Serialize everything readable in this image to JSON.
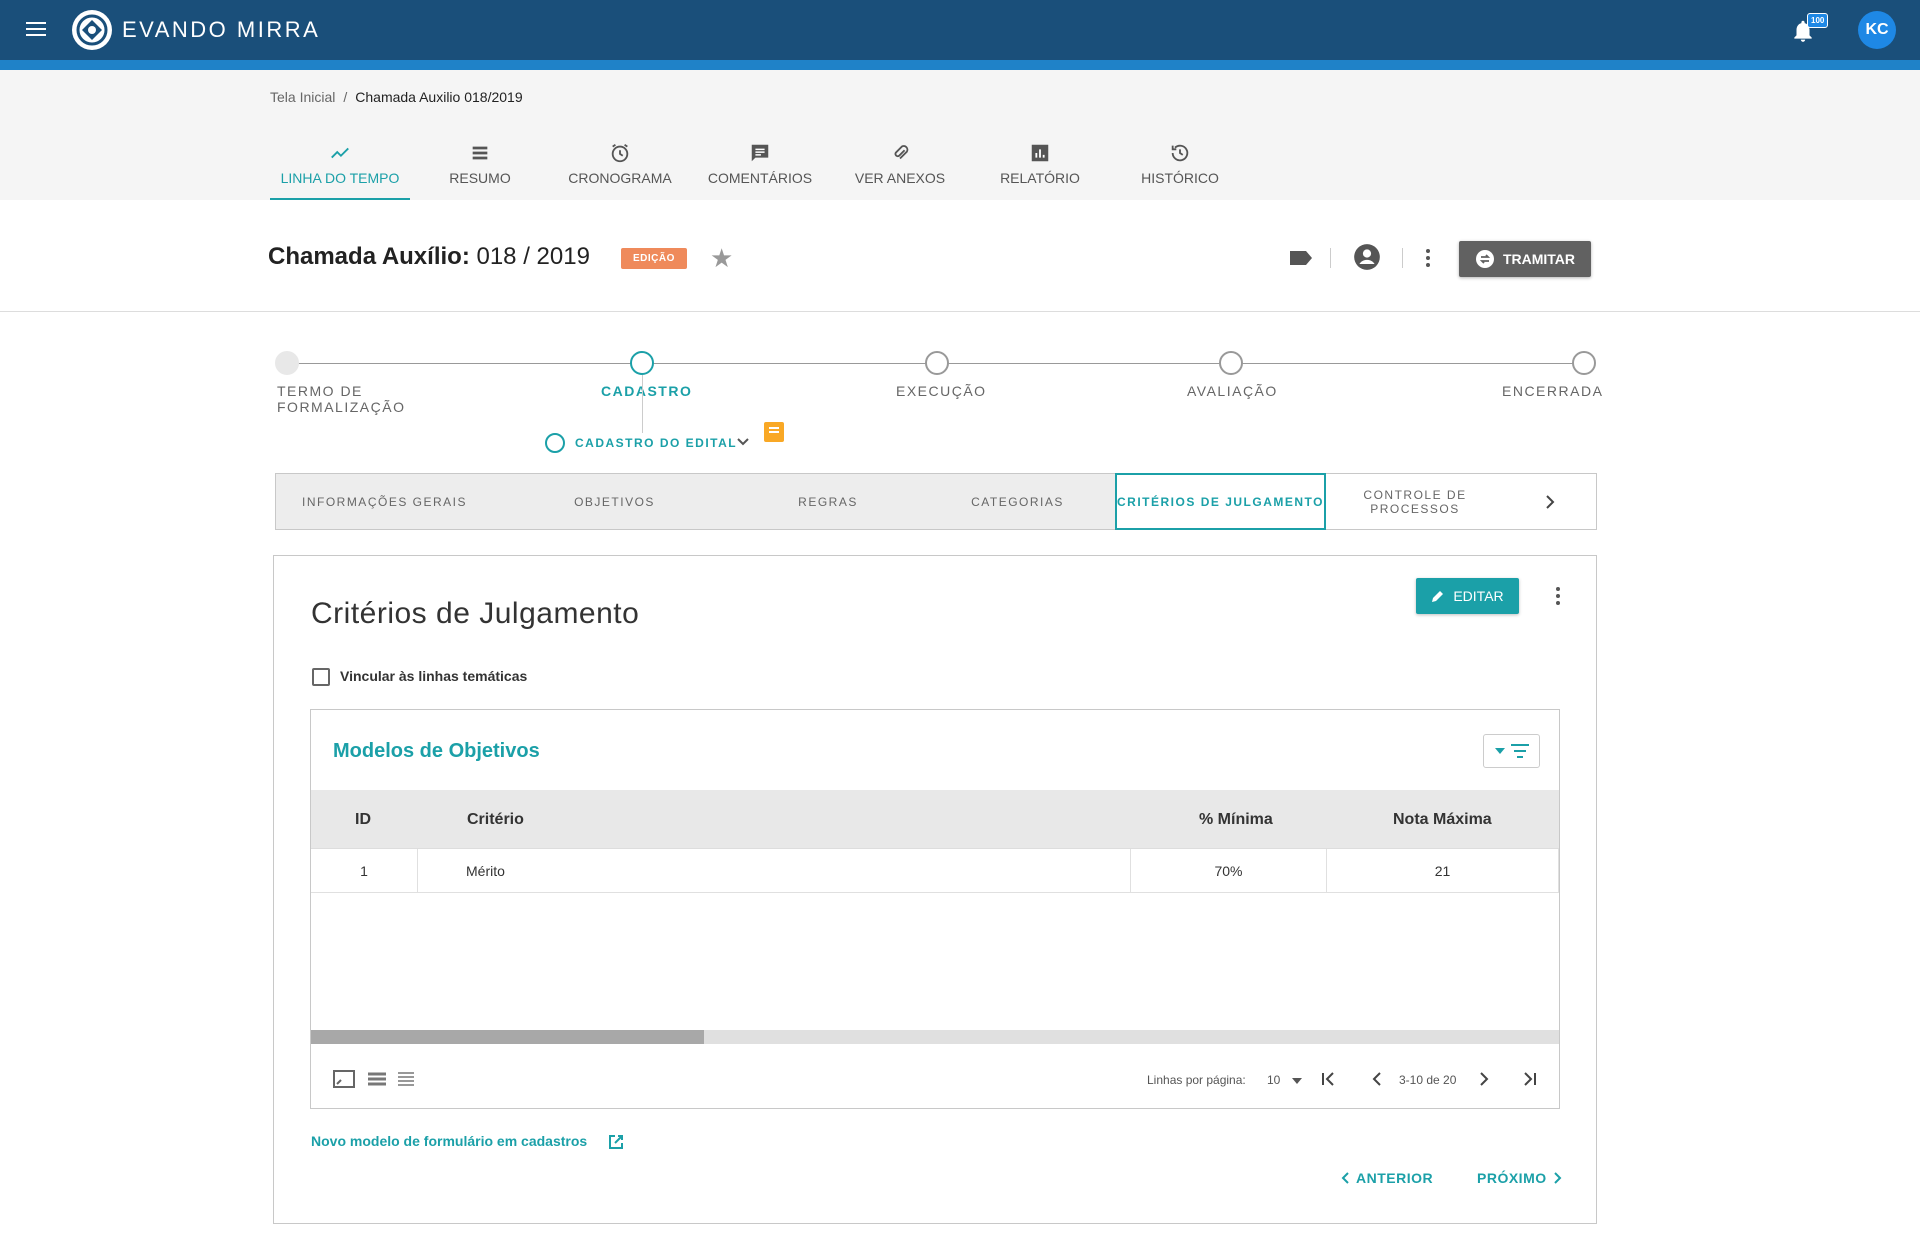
{
  "app": {
    "brand": "EVANDO MIRRA",
    "notification_count": "100",
    "user_initials": "KC"
  },
  "breadcrumb": {
    "home": "Tela Inicial",
    "separator": "/",
    "current": "Chamada Auxilio 018/2019"
  },
  "tabs": [
    {
      "label": "LINHA DO TEMPO",
      "icon": "timeline-icon",
      "active": true
    },
    {
      "label": "RESUMO",
      "icon": "list-icon"
    },
    {
      "label": "CRONOGRAMA",
      "icon": "alarm-icon"
    },
    {
      "label": "COMENTÁRIOS",
      "icon": "comment-icon"
    },
    {
      "label": "VER ANEXOS",
      "icon": "attachment-icon"
    },
    {
      "label": "RELATÓRIO",
      "icon": "report-icon"
    },
    {
      "label": "HISTÓRICO",
      "icon": "history-icon"
    }
  ],
  "title": {
    "prefix": "Chamada Auxílio:",
    "number": "018 / 2019",
    "status": "EDIÇÃO",
    "tramitar_label": "TRAMITAR"
  },
  "stepper": {
    "steps": [
      {
        "label": "TERMO DE FORMALIZAÇÃO",
        "state": "done"
      },
      {
        "label": "CADASTRO",
        "state": "active"
      },
      {
        "label": "EXECUÇÃO",
        "state": "pending"
      },
      {
        "label": "AVALIAÇÃO",
        "state": "pending"
      },
      {
        "label": "ENCERRADA",
        "state": "pending"
      }
    ],
    "substep": "CADASTRO DO EDITAL"
  },
  "subtabs": [
    {
      "label": "INFORMAÇÕES GERAIS"
    },
    {
      "label": "OBJETIVOS"
    },
    {
      "label": "REGRAS"
    },
    {
      "label": "CATEGORIAS"
    },
    {
      "label": "CRITÉRIOS DE JULGAMENTO",
      "active": true
    },
    {
      "label": "CONTROLE DE PROCESSOS"
    }
  ],
  "card": {
    "title": "Critérios de Julgamento",
    "edit_label": "EDITAR",
    "checkbox_label": "Vincular às linhas temáticas",
    "table_title": "Modelos de Objetivos",
    "columns": [
      "ID",
      "Critério",
      "% Mínima",
      "Nota Máxima"
    ],
    "rows": [
      {
        "id": "1",
        "criterio": "Mérito",
        "minima": "70%",
        "nota": "21"
      }
    ],
    "scroll_position": 0.315,
    "pager": {
      "rows_per_page_label": "Linhas por página:",
      "rows_per_page": "10",
      "range": "3-10 de 20"
    },
    "new_model_link": "Novo modelo de formulário em cadastros",
    "prev_label": "ANTERIOR",
    "next_label": "PRÓXIMO"
  },
  "colors": {
    "appbar": "#1a4f7a",
    "accent": "#1ba0a8",
    "status_badge": "#ef8a5b",
    "comment_badge": "#f9a825",
    "tramitar": "#616161"
  }
}
